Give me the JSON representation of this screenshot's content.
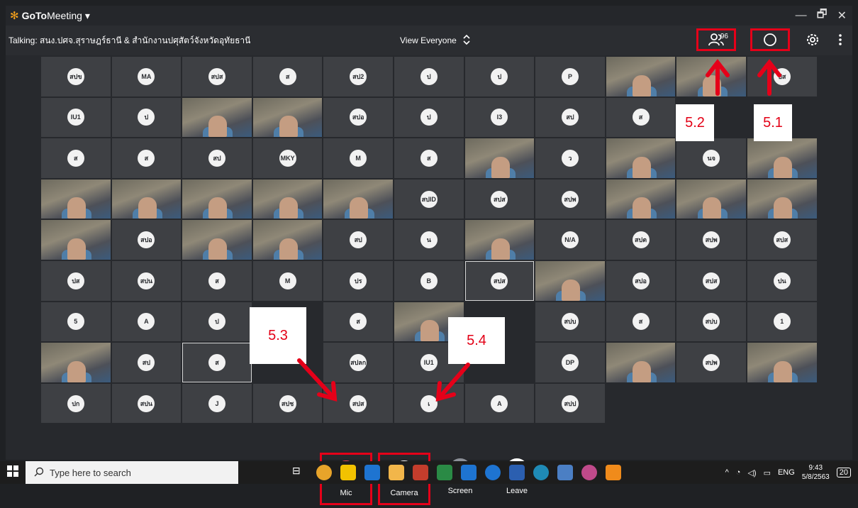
{
  "app": {
    "name": "GoToMeeting",
    "brand_bold": "GoTo",
    "brand_rest": "Meeting",
    "dropdown": "▾"
  },
  "window_controls": [
    "—",
    "🗗",
    "✕"
  ],
  "infobar": {
    "talking": "Talking: สนง.ปศจ.สุราษฎร์ธานี & สำนักงานปศุสัตว์จังหวัดอุทัยธานี",
    "view": "View Everyone",
    "participant_count": "96"
  },
  "tiles": [
    {
      "t": "a",
      "v": "สปข"
    },
    {
      "t": "a",
      "v": "MA"
    },
    {
      "t": "a",
      "v": "สปส"
    },
    {
      "t": "a",
      "v": "ส"
    },
    {
      "t": "a",
      "v": "สป2"
    },
    {
      "t": "a",
      "v": "ป"
    },
    {
      "t": "a",
      "v": "ป"
    },
    {
      "t": "a",
      "v": "P"
    },
    {
      "t": "v"
    },
    {
      "t": "v"
    },
    {
      "t": "a",
      "v": "ปส"
    },
    {
      "t": "a",
      "v": "IU1"
    },
    {
      "t": "a",
      "v": "ป"
    },
    {
      "t": "v"
    },
    {
      "t": "v"
    },
    {
      "t": "a",
      "v": "สปอ"
    },
    {
      "t": "a",
      "v": "ป"
    },
    {
      "t": "a",
      "v": "I3"
    },
    {
      "t": "a",
      "v": "สป"
    },
    {
      "t": "a",
      "v": "ส"
    },
    {
      "t": "e"
    },
    {
      "t": "e"
    },
    {
      "t": "a",
      "v": "ส"
    },
    {
      "t": "a",
      "v": "ส"
    },
    {
      "t": "a",
      "v": "สป"
    },
    {
      "t": "a",
      "v": "MKY"
    },
    {
      "t": "a",
      "v": "M"
    },
    {
      "t": "a",
      "v": "ส"
    },
    {
      "t": "v"
    },
    {
      "t": "a",
      "v": "ว"
    },
    {
      "t": "v"
    },
    {
      "t": "a",
      "v": "นจ"
    },
    {
      "t": "v"
    },
    {
      "t": "v"
    },
    {
      "t": "v"
    },
    {
      "t": "v"
    },
    {
      "t": "v"
    },
    {
      "t": "v"
    },
    {
      "t": "a",
      "v": "สปID"
    },
    {
      "t": "a",
      "v": "สปส"
    },
    {
      "t": "a",
      "v": "สปพ"
    },
    {
      "t": "v"
    },
    {
      "t": "v"
    },
    {
      "t": "v"
    },
    {
      "t": "v"
    },
    {
      "t": "a",
      "v": "สปอ"
    },
    {
      "t": "v"
    },
    {
      "t": "v"
    },
    {
      "t": "a",
      "v": "สป"
    },
    {
      "t": "a",
      "v": "น"
    },
    {
      "t": "v"
    },
    {
      "t": "a",
      "v": "N/A"
    },
    {
      "t": "a",
      "v": "สปต"
    },
    {
      "t": "a",
      "v": "สปพ"
    },
    {
      "t": "a",
      "v": "สปส"
    },
    {
      "t": "a",
      "v": "ปส"
    },
    {
      "t": "a",
      "v": "สปน"
    },
    {
      "t": "a",
      "v": "ส"
    },
    {
      "t": "a",
      "v": "M"
    },
    {
      "t": "a",
      "v": "ปร"
    },
    {
      "t": "a",
      "v": "B"
    },
    {
      "t": "a",
      "v": "สปส",
      "hl": true
    },
    {
      "t": "v"
    },
    {
      "t": "a",
      "v": "สปอ"
    },
    {
      "t": "a",
      "v": "สปส"
    },
    {
      "t": "a",
      "v": "ปน"
    },
    {
      "t": "a",
      "v": "5"
    },
    {
      "t": "a",
      "v": "A"
    },
    {
      "t": "a",
      "v": "ป"
    },
    {
      "t": "e"
    },
    {
      "t": "a",
      "v": "ส"
    },
    {
      "t": "v"
    },
    {
      "t": "e"
    },
    {
      "t": "a",
      "v": "สปบ"
    },
    {
      "t": "a",
      "v": "ส"
    },
    {
      "t": "a",
      "v": "สปบ"
    },
    {
      "t": "a",
      "v": "1"
    },
    {
      "t": "v"
    },
    {
      "t": "a",
      "v": "สป"
    },
    {
      "t": "a",
      "v": "ส",
      "hl": true
    },
    {
      "t": "e"
    },
    {
      "t": "a",
      "v": "สปลก"
    },
    {
      "t": "a",
      "v": "IU1"
    },
    {
      "t": "e"
    },
    {
      "t": "a",
      "v": "DP"
    },
    {
      "t": "v"
    },
    {
      "t": "a",
      "v": "สปพ"
    },
    {
      "t": "v"
    },
    {
      "t": "a",
      "v": "ปก"
    },
    {
      "t": "a",
      "v": "สปน"
    },
    {
      "t": "a",
      "v": "J"
    },
    {
      "t": "a",
      "v": "สปช"
    },
    {
      "t": "a",
      "v": "สปส"
    },
    {
      "t": "a",
      "v": "เ"
    },
    {
      "t": "a",
      "v": "A"
    },
    {
      "t": "a",
      "v": "สปป"
    },
    {
      "t": "e"
    },
    {
      "t": "e"
    },
    {
      "t": "e"
    }
  ],
  "annotations": {
    "a51": "5.1",
    "a52": "5.2",
    "a53": "5.3",
    "a54": "5.4"
  },
  "controls": {
    "mic": "Mic",
    "camera": "Camera",
    "screen": "Screen",
    "leave": "Leave"
  },
  "taskbar": {
    "search_placeholder": "Type here to search",
    "lang": "ENG",
    "time": "9:43",
    "date": "5/8/2563",
    "notifications": "20"
  }
}
